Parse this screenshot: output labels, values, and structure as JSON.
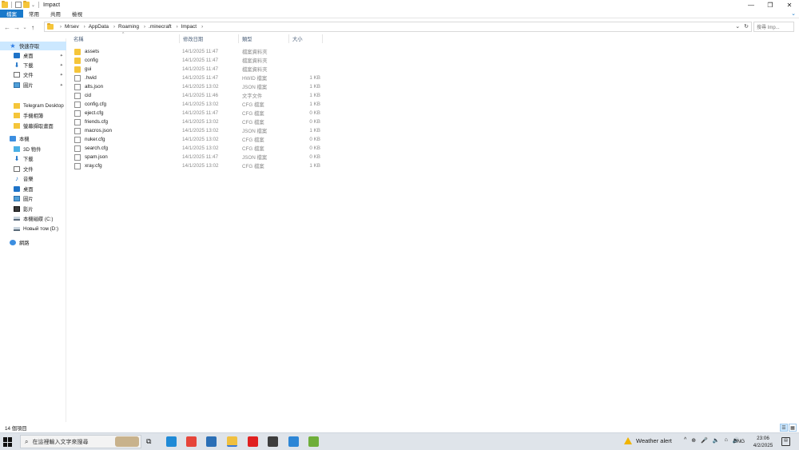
{
  "window": {
    "title": "Impact",
    "controls": {
      "minimize": "—",
      "maximize": "❐",
      "close": "✕"
    }
  },
  "ribbon": {
    "tabs": [
      "檔案",
      "常用",
      "共用",
      "檢視"
    ],
    "expand_glyph": "⌄"
  },
  "address": {
    "back": "←",
    "forward": "→",
    "recent": "⌄",
    "up": "↑",
    "breadcrumbs": [
      "Mrsev",
      "AppData",
      "Roaming",
      ".minecraft",
      "Impact"
    ],
    "crumb_separator": "›",
    "dropdown_glyph": "⌄",
    "refresh_glyph": "↻",
    "search_placeholder": "搜尋 Imp..."
  },
  "navpane": {
    "items": [
      {
        "label": "快速存取",
        "icon": "star-icon",
        "selected": true,
        "pinned": false
      },
      {
        "label": "桌面",
        "icon": "desktop-icon",
        "selected": false,
        "pinned": true
      },
      {
        "label": "下載",
        "icon": "download-icon",
        "selected": false,
        "pinned": true
      },
      {
        "label": "文件",
        "icon": "documents-icon",
        "selected": false,
        "pinned": true
      },
      {
        "label": "圖片",
        "icon": "pictures-icon",
        "selected": false,
        "pinned": true
      },
      {
        "label": "Telegram Desktop",
        "icon": "folder-icon",
        "selected": false,
        "pinned": false
      },
      {
        "label": "手機相簿",
        "icon": "folder-icon",
        "selected": false,
        "pinned": false
      },
      {
        "label": "螢幕擷取畫面",
        "icon": "folder-icon",
        "selected": false,
        "pinned": false
      },
      {
        "label": "本機",
        "icon": "this-pc-icon",
        "selected": false,
        "pinned": false
      },
      {
        "label": "3D 物件",
        "icon": "3d-objects-icon",
        "selected": false,
        "pinned": false
      },
      {
        "label": "下載",
        "icon": "download-icon",
        "selected": false,
        "pinned": false
      },
      {
        "label": "文件",
        "icon": "documents-icon",
        "selected": false,
        "pinned": false
      },
      {
        "label": "音樂",
        "icon": "music-icon",
        "selected": false,
        "pinned": false
      },
      {
        "label": "桌面",
        "icon": "desktop-icon",
        "selected": false,
        "pinned": false
      },
      {
        "label": "圖片",
        "icon": "pictures-icon",
        "selected": false,
        "pinned": false
      },
      {
        "label": "影片",
        "icon": "videos-icon",
        "selected": false,
        "pinned": false
      },
      {
        "label": "本機磁碟 (C:)",
        "icon": "drive-icon",
        "selected": false,
        "pinned": false
      },
      {
        "label": "Новый том (D:)",
        "icon": "drive-icon",
        "selected": false,
        "pinned": false
      },
      {
        "label": "網路",
        "icon": "network-icon",
        "selected": false,
        "pinned": false
      }
    ],
    "pin_glyph": "📌"
  },
  "filelist": {
    "columns": {
      "name": "名稱",
      "date": "修改日期",
      "type": "類型",
      "size": "大小"
    },
    "sort_glyph": "^",
    "rows": [
      {
        "name": "assets",
        "date": "14/1/2025 11:47",
        "type": "檔案資料夾",
        "size": "",
        "kind": "folder"
      },
      {
        "name": "config",
        "date": "14/1/2025 11:47",
        "type": "檔案資料夾",
        "size": "",
        "kind": "folder"
      },
      {
        "name": "gui",
        "date": "14/1/2025 11:47",
        "type": "檔案資料夾",
        "size": "",
        "kind": "folder"
      },
      {
        "name": ".hwid",
        "date": "14/1/2025 11:47",
        "type": "HWID 檔案",
        "size": "1 KB",
        "kind": "file"
      },
      {
        "name": "alts.json",
        "date": "14/1/2025 13:02",
        "type": "JSON 檔案",
        "size": "1 KB",
        "kind": "file"
      },
      {
        "name": "cid",
        "date": "14/1/2025 11:46",
        "type": "文字文件",
        "size": "1 KB",
        "kind": "file"
      },
      {
        "name": "config.cfg",
        "date": "14/1/2025 13:02",
        "type": "CFG 檔案",
        "size": "1 KB",
        "kind": "file"
      },
      {
        "name": "eject.cfg",
        "date": "14/1/2025 11:47",
        "type": "CFG 檔案",
        "size": "0 KB",
        "kind": "file"
      },
      {
        "name": "friends.cfg",
        "date": "14/1/2025 13:02",
        "type": "CFG 檔案",
        "size": "0 KB",
        "kind": "file"
      },
      {
        "name": "macros.json",
        "date": "14/1/2025 13:02",
        "type": "JSON 檔案",
        "size": "1 KB",
        "kind": "file"
      },
      {
        "name": "nuker.cfg",
        "date": "14/1/2025 13:02",
        "type": "CFG 檔案",
        "size": "0 KB",
        "kind": "file"
      },
      {
        "name": "search.cfg",
        "date": "14/1/2025 13:02",
        "type": "CFG 檔案",
        "size": "0 KB",
        "kind": "file"
      },
      {
        "name": "spam.json",
        "date": "14/1/2025 11:47",
        "type": "JSON 檔案",
        "size": "0 KB",
        "kind": "file"
      },
      {
        "name": "xray.cfg",
        "date": "14/1/2025 13:02",
        "type": "CFG 檔案",
        "size": "1 KB",
        "kind": "file"
      }
    ]
  },
  "statusbar": {
    "item_count": "14 個項目",
    "details_view_glyph": "☰",
    "icons_view_glyph": "▦"
  },
  "taskbar": {
    "search_placeholder": "在這裡輸入文字來搜尋",
    "search_glyph": "⌕",
    "task_view_glyph": "⧉",
    "pinned_apps": [
      {
        "icon": "edge-icon",
        "color": "#1f8ad6"
      },
      {
        "icon": "chrome-icon",
        "color": "#e6453a"
      },
      {
        "icon": "store-icon",
        "color": "#2b6fb6"
      },
      {
        "icon": "file-explorer-icon",
        "color": "#f0c040",
        "active": true
      },
      {
        "icon": "youtube-icon",
        "color": "#e02020"
      },
      {
        "icon": "minecraft-launcher-icon",
        "color": "#3d3d3d"
      },
      {
        "icon": "paint-icon",
        "color": "#2d86d6"
      },
      {
        "icon": "minecraft-icon",
        "color": "#6fae3a"
      }
    ],
    "weather": "Weather alert",
    "tray_glyphs": [
      "^",
      "⊕",
      "🎤",
      "🔈",
      "⌂",
      "🔊"
    ],
    "language": "ENG",
    "time": "23:06",
    "date": "4/2/2025",
    "notifications_glyph": "▤"
  }
}
